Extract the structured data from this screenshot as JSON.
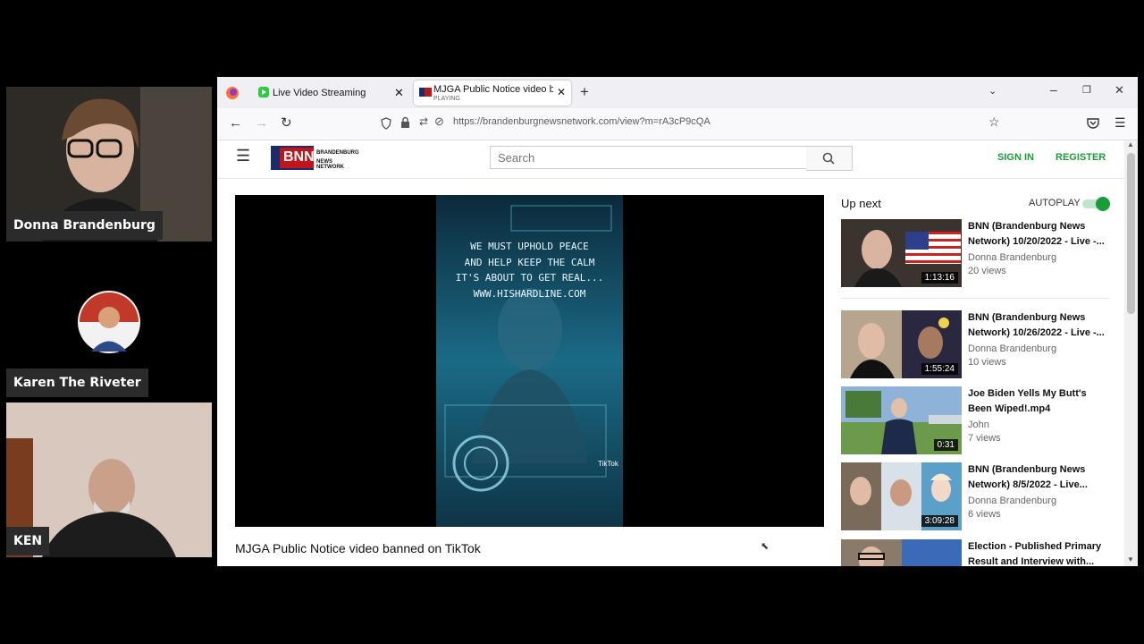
{
  "participants": [
    {
      "name": "Donna Brandenburg"
    },
    {
      "name": "Karen The Riveter"
    },
    {
      "name": "KEN"
    }
  ],
  "browser": {
    "tabs": [
      {
        "label": "Live Video Streaming"
      },
      {
        "label": "MJGA Public Notice video banned",
        "sub": "PLAYING"
      }
    ],
    "url": "https://brandenburgnewsnetwork.com/view?m=rA3cP9cQA"
  },
  "site": {
    "logo_letters": "BNN",
    "logo_line1": "BRANDENBURG",
    "logo_line2": "NEWS NETWORK",
    "search_placeholder": "Search",
    "sign_in": "SIGN IN",
    "register": "REGISTER",
    "accent": "#1a9c3a"
  },
  "player": {
    "overlay_lines": [
      "WE MUST UPHOLD PEACE",
      "AND HELP KEEP THE CALM",
      "IT'S ABOUT TO GET REAL...",
      "WWW.HISHARDLINE.COM"
    ],
    "watermark": "TikTok",
    "video_title": "MJGA Public Notice video banned on TikTok"
  },
  "upnext": {
    "label": "Up next",
    "autoplay_label": "AUTOPLAY",
    "items": [
      {
        "title": "BNN (Brandenburg News Network) 10/20/2022 - Live -...",
        "author": "Donna Brandenburg",
        "views": "20 views",
        "duration": "1:13:16"
      },
      {
        "title": "BNN (Brandenburg News Network) 10/26/2022 - Live -...",
        "author": "Donna Brandenburg",
        "views": "10 views",
        "duration": "1:55:24"
      },
      {
        "title": "Joe Biden Yells My Butt's Been Wiped!.mp4",
        "author": "John",
        "views": "7 views",
        "duration": "0:31"
      },
      {
        "title": "BNN (Brandenburg News Network) 8/5/2022 - Live...",
        "author": "Donna Brandenburg",
        "views": "6 views",
        "duration": "3:09:28"
      },
      {
        "title": "Election - Published Primary Result and Interview with...",
        "author": "",
        "views": "",
        "duration": ""
      }
    ]
  }
}
